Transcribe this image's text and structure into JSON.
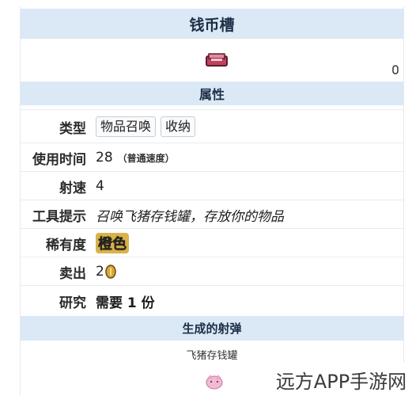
{
  "title": "钱币槽",
  "attr_heading": "属性",
  "rows": [
    {
      "label": "类型",
      "tags": [
        "物品召唤",
        "收纳"
      ]
    },
    {
      "label": "使用时间",
      "value": "28",
      "note": "（普通速度）"
    },
    {
      "label": "射速",
      "value": "4"
    },
    {
      "label": "工具提示",
      "value": "召唤飞猪存钱罐，存放你的物品"
    },
    {
      "label": "稀有度",
      "value": "橙色"
    },
    {
      "label": "卖出",
      "value": "2"
    },
    {
      "label": "研究",
      "value": "需要 1 份"
    }
  ],
  "projectile_heading": "生成的射弹",
  "projectile_name": "飞猪存钱罐",
  "watermark": "远方APP手游网",
  "colors": {
    "header_bg": "#dbe8f5",
    "research": "#b21fa6",
    "coin": "#d8a737",
    "item_pink": "#d05a7a"
  },
  "icons": [
    "money-trough-icon",
    "gold-coin-icon",
    "flying-piggy-bank-icon"
  ]
}
